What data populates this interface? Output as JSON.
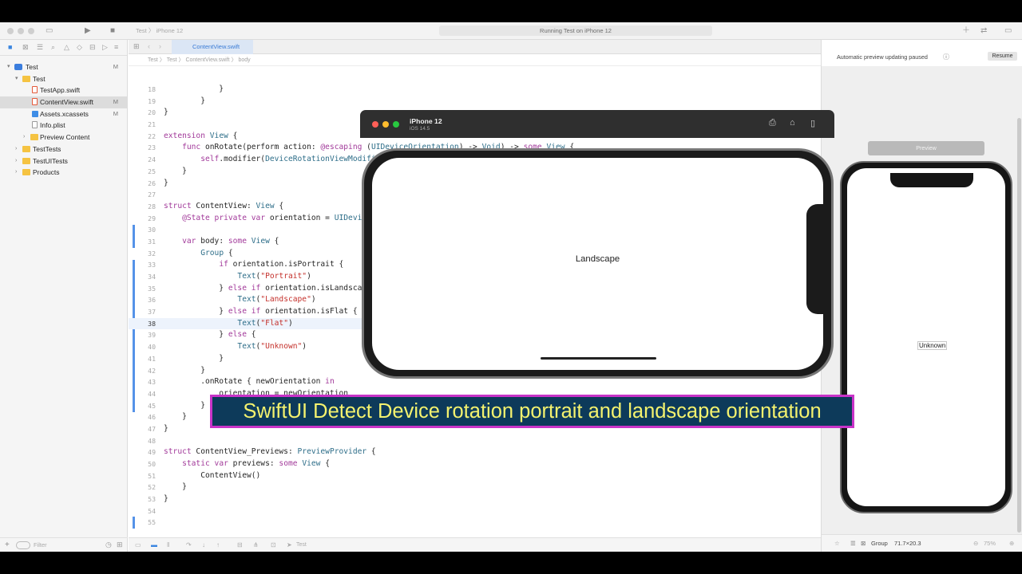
{
  "toolbar": {
    "scheme_project": "Test",
    "scheme_device": "iPhone 12",
    "status": "Running Test on iPhone 12"
  },
  "tab": {
    "label": "ContentView.swift"
  },
  "jump_bar": [
    "Test",
    "Test",
    "ContentView.swift",
    "body"
  ],
  "navigator": {
    "items": [
      {
        "label": "Test",
        "status": "M"
      },
      {
        "label": "Test",
        "status": ""
      },
      {
        "label": "TestApp.swift",
        "status": ""
      },
      {
        "label": "ContentView.swift",
        "status": "M"
      },
      {
        "label": "Assets.xcassets",
        "status": "M"
      },
      {
        "label": "Info.plist",
        "status": ""
      },
      {
        "label": "Preview Content",
        "status": ""
      },
      {
        "label": "TestTests",
        "status": ""
      },
      {
        "label": "TestUITests",
        "status": ""
      },
      {
        "label": "Products",
        "status": ""
      }
    ],
    "filter_placeholder": "Filter"
  },
  "code": {
    "lines": [
      {
        "n": "18",
        "t": "            }"
      },
      {
        "n": "19",
        "t": "        }"
      },
      {
        "n": "20",
        "t": "}"
      },
      {
        "n": "21",
        "t": ""
      },
      {
        "n": "22",
        "t": "extension View {"
      },
      {
        "n": "23",
        "t": "    func onRotate(perform action: @escaping (UIDeviceOrientation) -> Void) -> some View {"
      },
      {
        "n": "24",
        "t": "        self.modifier(DeviceRotationViewModifier(action: action))"
      },
      {
        "n": "25",
        "t": "    }"
      },
      {
        "n": "26",
        "t": "}"
      },
      {
        "n": "27",
        "t": ""
      },
      {
        "n": "28",
        "t": "struct ContentView: View {"
      },
      {
        "n": "29",
        "t": "    @State private var orientation = UIDeviceOrientation.unknown"
      },
      {
        "n": "30",
        "t": ""
      },
      {
        "n": "31",
        "t": "    var body: some View {"
      },
      {
        "n": "32",
        "t": "        Group {"
      },
      {
        "n": "33",
        "t": "            if orientation.isPortrait {"
      },
      {
        "n": "34",
        "t": "                Text(\"Portrait\")"
      },
      {
        "n": "35",
        "t": "            } else if orientation.isLandscape {"
      },
      {
        "n": "36",
        "t": "                Text(\"Landscape\")"
      },
      {
        "n": "37",
        "t": "            } else if orientation.isFlat {"
      },
      {
        "n": "38",
        "t": "                Text(\"Flat\")"
      },
      {
        "n": "39",
        "t": "            } else {"
      },
      {
        "n": "40",
        "t": "                Text(\"Unknown\")"
      },
      {
        "n": "41",
        "t": "            }"
      },
      {
        "n": "42",
        "t": "        }"
      },
      {
        "n": "43",
        "t": "        .onRotate { newOrientation in"
      },
      {
        "n": "44",
        "t": "            orientation = newOrientation"
      },
      {
        "n": "45",
        "t": "        }"
      },
      {
        "n": "46",
        "t": "    }"
      },
      {
        "n": "47",
        "t": "}"
      },
      {
        "n": "48",
        "t": ""
      },
      {
        "n": "49",
        "t": "struct ContentView_Previews: PreviewProvider {"
      },
      {
        "n": "50",
        "t": "    static var previews: some View {"
      },
      {
        "n": "51",
        "t": "        ContentView()"
      },
      {
        "n": "52",
        "t": "    }"
      },
      {
        "n": "53",
        "t": "}"
      },
      {
        "n": "54",
        "t": ""
      },
      {
        "n": "55",
        "t": ""
      }
    ],
    "current_line": "38"
  },
  "simulator": {
    "title": "iPhone 12",
    "subtitle": "iOS 14.5",
    "screen_text": "Landscape"
  },
  "canvas": {
    "paused_text": "Automatic preview updating paused",
    "resume_label": "Resume",
    "preview_label": "Preview",
    "preview_text": "Unknown",
    "footer_group": "Group",
    "footer_size": "71.7×20.3",
    "zoom": "75%"
  },
  "bottom_bar": {
    "target": "Test"
  },
  "caption": "SwiftUI Detect Device rotation portrait and landscape orientation",
  "colors": {
    "keyword": "#a23a9a",
    "type": "#2e6e89",
    "string": "#c4302b",
    "caption_text": "#f4f26e",
    "caption_border": "#c833c8"
  }
}
